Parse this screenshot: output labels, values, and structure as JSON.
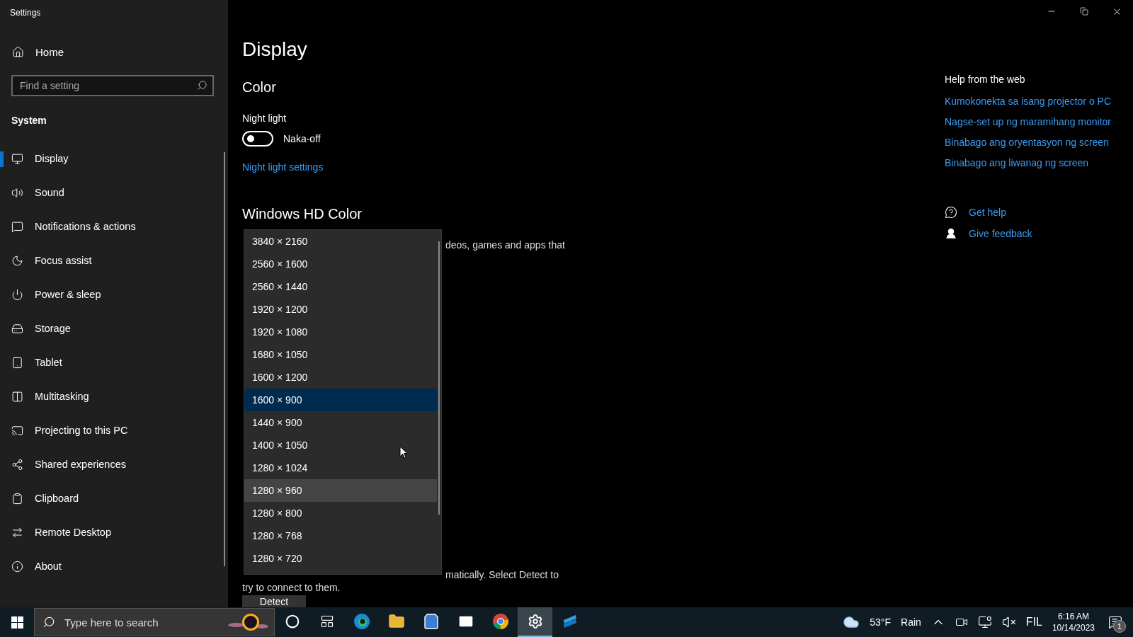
{
  "window": {
    "title": "Settings"
  },
  "sidebar": {
    "home": "Home",
    "search": {
      "placeholder": "Find a setting"
    },
    "section": "System",
    "items": [
      {
        "label": "Display",
        "selected": true
      },
      {
        "label": "Sound",
        "selected": false
      },
      {
        "label": "Notifications & actions",
        "selected": false
      },
      {
        "label": "Focus assist",
        "selected": false
      },
      {
        "label": "Power & sleep",
        "selected": false
      },
      {
        "label": "Storage",
        "selected": false
      },
      {
        "label": "Tablet",
        "selected": false
      },
      {
        "label": "Multitasking",
        "selected": false
      },
      {
        "label": "Projecting to this PC",
        "selected": false
      },
      {
        "label": "Shared experiences",
        "selected": false
      },
      {
        "label": "Clipboard",
        "selected": false
      },
      {
        "label": "Remote Desktop",
        "selected": false
      },
      {
        "label": "About",
        "selected": false
      }
    ]
  },
  "main": {
    "title": "Display",
    "section": "Color",
    "night_light": {
      "label": "Night light",
      "on": false,
      "state_text": "Naka-off"
    },
    "night_light_link": "Night light settings",
    "hd_title": "Windows HD Color",
    "hd_text": "deos, games and apps that",
    "detect_text_1": "matically. Select Detect to",
    "detect_text_2": "try to connect to them.",
    "detect_button": "Detect"
  },
  "dropdown": {
    "options": [
      {
        "label": "3840 × 2160",
        "selected": false,
        "hovered": false
      },
      {
        "label": "2560 × 1600",
        "selected": false,
        "hovered": false
      },
      {
        "label": "2560 × 1440",
        "selected": false,
        "hovered": false
      },
      {
        "label": "1920 × 1200",
        "selected": false,
        "hovered": false
      },
      {
        "label": "1920 × 1080",
        "selected": false,
        "hovered": false
      },
      {
        "label": "1680 × 1050",
        "selected": false,
        "hovered": false
      },
      {
        "label": "1600 × 1200",
        "selected": false,
        "hovered": false
      },
      {
        "label": "1600 × 900",
        "selected": true,
        "hovered": false
      },
      {
        "label": "1440 × 900",
        "selected": false,
        "hovered": false
      },
      {
        "label": "1400 × 1050",
        "selected": false,
        "hovered": false
      },
      {
        "label": "1280 × 1024",
        "selected": false,
        "hovered": false
      },
      {
        "label": "1280 × 960",
        "selected": false,
        "hovered": true
      },
      {
        "label": "1280 × 800",
        "selected": false,
        "hovered": false
      },
      {
        "label": "1280 × 768",
        "selected": false,
        "hovered": false
      },
      {
        "label": "1280 × 720",
        "selected": false,
        "hovered": false
      }
    ]
  },
  "help": {
    "title": "Help from the web",
    "links": [
      "Kumokonekta sa isang projector o PC",
      "Nagse-set up ng maramihang monitor",
      "Binabago ang oryentasyon ng screen",
      "Binabago ang liwanag ng screen"
    ],
    "get_help": "Get help",
    "give_feedback": "Give feedback"
  },
  "taskbar": {
    "search": {
      "placeholder": "Type here to search"
    },
    "apps": [
      {
        "selected": false
      },
      {
        "selected": false
      },
      {
        "selected": false
      },
      {
        "selected": false
      },
      {
        "selected": false
      },
      {
        "selected": false
      },
      {
        "selected": false
      },
      {
        "selected": true
      },
      {
        "selected": false
      }
    ],
    "weather_temp": "53°F",
    "weather_text": "Rain",
    "language": "FIL",
    "time": "6:16 AM",
    "date": "10/14/2023",
    "notification_count": "1"
  }
}
